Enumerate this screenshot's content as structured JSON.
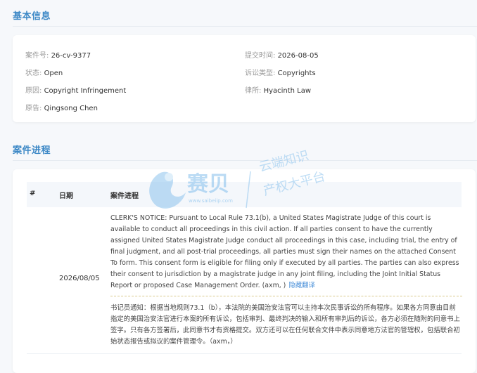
{
  "basic_info": {
    "title": "基本信息",
    "case_no_label": "案件号:",
    "case_no": "26-cv-9377",
    "filed_label": "提交时间:",
    "filed": "2026-08-05",
    "status_label": "状态:",
    "status": "Open",
    "type_label": "诉讼类型:",
    "type": "Copyrights",
    "cause_label": "原因:",
    "cause": "Copyright Infringement",
    "firm_label": "律所:",
    "firm": "Hyacinth Law",
    "plaintiff_label": "原告:",
    "plaintiff": "Qingsong Chen"
  },
  "progress": {
    "title": "案件进程",
    "col_num": "#",
    "col_date": "日期",
    "col_progress": "案件进程",
    "entry": {
      "date": "2026/08/05",
      "text_en": "CLERK'S NOTICE: Pursuant to Local Rule 73.1(b), a United States Magistrate Judge of this court is available to conduct all proceedings in this civil action. If all parties consent to have the currently assigned United States Magistrate Judge conduct all proceedings in this case, including trial, the entry of final judgment, and all post-trial proceedings, all parties must sign their names on the attached Consent To form. This consent form is eligible for filing only if executed by all parties. The parties can also express their consent to jurisdiction by a magistrate judge in any joint filing, including the Joint Initial Status Report or proposed Case Management Order. (axm, )",
      "hide_translation": "隐藏翻译",
      "text_zh": "书记员通知：根据当地规则73.1（b），本法院的美国治安法官可以主持本次民事诉讼的所有程序。如果各方同意由目前指定的美国治安法官进行本案的所有诉讼，包括审判、最终判决的输入和所有审判后的诉讼，各方必须在随附的同意书上签字。只有各方签署后，此同意书才有资格提交。双方还可以在任何联合文件中表示同意地方法官的管辖权，包括联合初始状态报告或拟议的案件管理令。（axm，）"
    }
  },
  "watermark": {
    "brand": "赛贝",
    "url": "www.saibeiip.com",
    "line1": "云端知识",
    "line2": "产权大平台",
    "color": "#7fb6e6"
  }
}
